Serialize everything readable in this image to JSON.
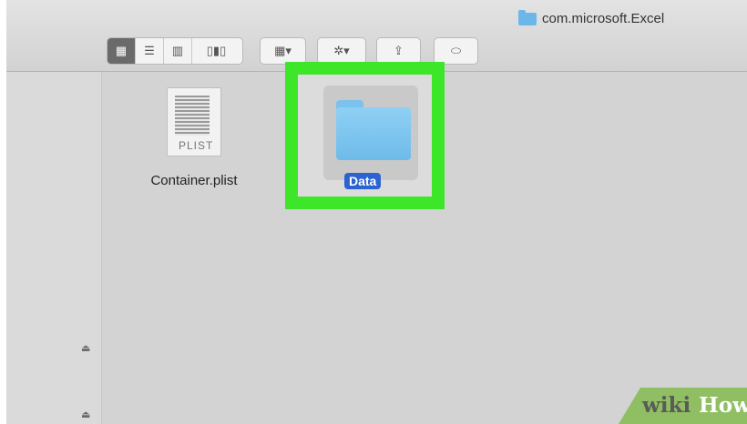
{
  "window": {
    "title": "com.microsoft.Excel"
  },
  "toolbar": {
    "view_buttons": [
      "icon-view",
      "list-view",
      "column-view",
      "gallery-view"
    ],
    "arrange_label": "▦▾",
    "action_label": "✲▾",
    "share_label": "⇪",
    "tag_label": "⬭"
  },
  "files": [
    {
      "name": "Container.plist",
      "icon": "plist-document-icon",
      "doc_text": "PLIST"
    },
    {
      "name": "Data",
      "icon": "folder-icon",
      "selected": true
    }
  ],
  "sidebar": {
    "eject_icons": [
      "eject-icon",
      "eject-icon"
    ]
  },
  "watermark": {
    "part1": "wiki",
    "part2": "How"
  },
  "colors": {
    "highlight": "#3ee62a",
    "selection": "#2b63d1",
    "folder": "#7cc2ee"
  }
}
